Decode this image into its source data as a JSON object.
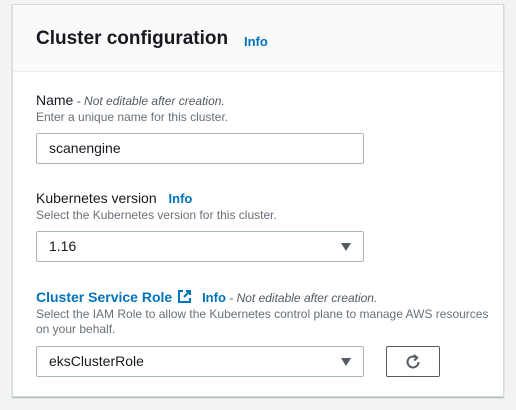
{
  "card": {
    "title": "Cluster configuration",
    "info": "Info"
  },
  "name_field": {
    "label": "Name",
    "separator": " - ",
    "note": "Not editable after creation.",
    "description": "Enter a unique name for this cluster.",
    "value": "scanengine"
  },
  "k8s_field": {
    "label": "Kubernetes version",
    "info": "Info",
    "description": "Select the Kubernetes version for this cluster.",
    "value": "1.16"
  },
  "role_field": {
    "label": "Cluster Service Role",
    "info": "Info",
    "separator": " - ",
    "note": "Not editable after creation.",
    "description": "Select the IAM Role to allow the Kubernetes control plane to manage AWS resources on your behalf.",
    "value": "eksClusterRole"
  },
  "icons": {
    "external_link": "external-link-icon",
    "dropdown": "caret-down-icon",
    "refresh": "refresh-icon"
  },
  "colors": {
    "link": "#0073bb",
    "text": "#16191f",
    "muted": "#687078"
  }
}
